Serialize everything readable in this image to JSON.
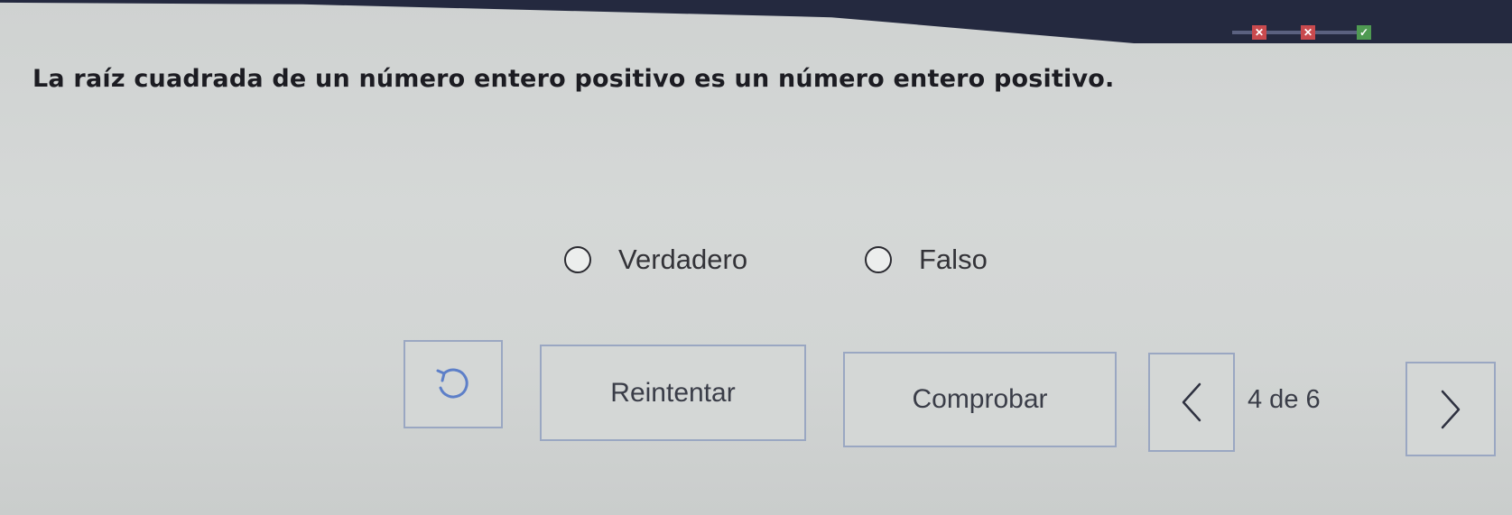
{
  "question": {
    "text": "La raíz cuadrada de un número entero positivo es un número entero positivo."
  },
  "progress": {
    "marks": [
      {
        "status": "incorrect",
        "glyph": "✕",
        "color": "#c94a4e"
      },
      {
        "status": "incorrect",
        "glyph": "✕",
        "color": "#c94a4e"
      },
      {
        "status": "correct",
        "glyph": "✓",
        "color": "#4f9a52"
      }
    ]
  },
  "options": [
    {
      "label": "Verdadero",
      "selected": false
    },
    {
      "label": "Falso",
      "selected": false
    }
  ],
  "controls": {
    "retry_icon": "undo-arrow-icon",
    "retry_label": "Reintentar",
    "check_label": "Comprobar",
    "prev_icon": "chevron-left-icon",
    "next_icon": "chevron-right-icon",
    "page_indicator": "4 de 6"
  }
}
